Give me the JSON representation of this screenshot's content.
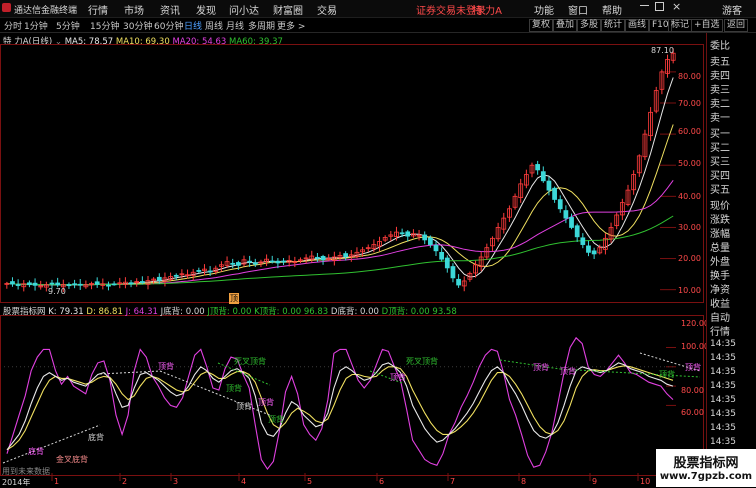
{
  "menu": {
    "app_title": "通达信金融终端",
    "items": [
      "行情",
      "市场",
      "资讯",
      "发现",
      "问小达",
      "财富圈",
      "交易"
    ],
    "right_items": [
      "功能",
      "窗口",
      "帮助",
      "游客"
    ],
    "login_warning": "证券交易未登录",
    "stock_tag": "特 力A"
  },
  "periods": {
    "items": [
      "分时",
      "1分钟",
      "5分钟",
      "15分钟",
      "30分钟",
      "60分钟",
      "日线",
      "周线",
      "月线",
      "多周期",
      "更多 >"
    ],
    "selected": "日线"
  },
  "tools": [
    "复权",
    "叠加",
    "多股",
    "统计",
    "画线",
    "F10",
    "标记",
    "+自选",
    "返回"
  ],
  "price_info": {
    "name": "特 力A(日线)",
    "ma5": "MA5: 78.57",
    "ma10": "MA10: 69.30",
    "ma20": "MA20: 54.63",
    "ma60": "MA60: 39.37"
  },
  "price_axis": [
    "80.00",
    "70.00",
    "60.00",
    "50.00",
    "40.00",
    "30.00",
    "20.00",
    "10.00"
  ],
  "price_marks": {
    "high": "87.10",
    "low": "9.70",
    "ding": "顶"
  },
  "indicator_info": {
    "name": "股票指标网",
    "k": "K: 79.31",
    "d": "D: 86.81",
    "j": "J: 64.31",
    "j_di": "J底背: 0.00",
    "j_ding": "J顶背: 0.00",
    "k_ding": "K顶背: 0.00",
    "v1": "96.83",
    "d_di": "D底背: 0.00",
    "d_ding": "D顶背: 0.00",
    "v2": "93.58"
  },
  "indicator_axis": [
    "120.00",
    "100.00",
    "80.00",
    "60.00"
  ],
  "indicator_labels": {
    "ding_bei": "顶背",
    "di_bei": "底背",
    "si_cha": "死叉顶背",
    "jin_cha": "金叉底背"
  },
  "date_axis": [
    "2014年",
    "1",
    "2",
    "3",
    "4",
    "5",
    "6",
    "7",
    "8",
    "9",
    "10"
  ],
  "footer_note": "用到未来数据",
  "side_panel": {
    "top": "委比",
    "rows": [
      "卖五",
      "卖四",
      "卖三",
      "卖二",
      "卖一",
      "买一",
      "买二",
      "买三",
      "买四",
      "买五",
      "现价",
      "涨跌",
      "涨幅",
      "总量",
      "外盘",
      "换手",
      "净资",
      "收益"
    ],
    "bottom": [
      "自动",
      "行情",
      "14:35",
      "14:35",
      "14:35",
      "14:35",
      "14:35",
      "14:35",
      "14:35",
      "14:35"
    ]
  },
  "watermark": {
    "line1": "股票指标网",
    "line2": "www.7gpzb.com"
  },
  "colors": {
    "up": "#ff3c3c",
    "down": "#3cd8d8",
    "ma5": "#e8e8e8",
    "ma10": "#f0e060",
    "ma20": "#e040e0",
    "ma60": "#30c030",
    "k": "#e8e8e8",
    "d": "#f0e060",
    "j": "#e040e0"
  },
  "chart_data": {
    "type": "candlestick",
    "ylim": [
      7,
      88
    ],
    "closes": [
      12,
      11.8,
      11.5,
      11.9,
      11.6,
      11.4,
      11.2,
      11.6,
      11.9,
      11.5,
      11.7,
      11.3,
      11.8,
      11.5,
      11.6,
      12.0,
      11.7,
      11.9,
      11.4,
      11.8,
      12.2,
      12.4,
      12.0,
      12.6,
      12.3,
      12.9,
      13.4,
      13.0,
      13.8,
      14.2,
      14.6,
      15.1,
      14.8,
      15.6,
      16.0,
      16.6,
      15.8,
      16.9,
      18.0,
      19.0,
      18.4,
      17.8,
      19.6,
      19.0,
      18.2,
      18.9,
      19.8,
      19.2,
      18.6,
      18.9,
      19.4,
      19.0,
      19.6,
      20.2,
      20.8,
      20.2,
      19.6,
      20.0,
      20.5,
      21.0,
      20.6,
      21.2,
      22.0,
      22.8,
      23.5,
      24.5,
      25.5,
      26.8,
      27.6,
      28.5,
      28.0,
      27.2,
      28.0,
      27.5,
      26.0,
      24.5,
      22.5,
      19.8,
      17.0,
      13.8,
      11.5,
      12.8,
      15.2,
      18.0,
      20.5,
      23.5,
      26.5,
      30.0,
      33.0,
      36.0,
      40.0,
      44.0,
      47.0,
      50.0,
      48.5,
      45.0,
      42.0,
      39.0,
      36.0,
      33.0,
      30.0,
      27.0,
      24.5,
      22.0,
      21.5,
      23.5,
      26.5,
      30.0,
      34.0,
      38.0,
      42.0,
      47.0,
      53.0,
      60.0,
      67.0,
      74.0,
      80.0,
      84.0,
      86.0
    ],
    "ma_series": [
      "MA5",
      "MA10",
      "MA20",
      "MA60"
    ],
    "kdj_k": [
      14,
      22,
      30,
      44,
      62,
      78,
      90,
      94,
      90,
      86,
      88,
      84,
      82,
      80,
      86,
      92,
      94,
      88,
      72,
      58,
      60,
      78,
      92,
      94,
      90,
      86,
      80,
      74,
      70,
      72,
      80,
      92,
      100,
      96,
      88,
      84,
      90,
      96,
      98,
      94,
      88,
      70,
      42,
      30,
      28,
      36,
      52,
      64,
      60,
      50,
      44,
      38,
      40,
      52,
      78,
      96,
      100,
      96,
      90,
      86,
      88,
      94,
      102,
      104,
      100,
      94,
      80,
      60,
      48,
      36,
      28,
      22,
      24,
      30,
      36,
      44,
      52,
      62,
      74,
      86,
      96,
      100,
      94,
      82,
      72,
      60,
      46,
      34,
      28,
      26,
      30,
      42,
      60,
      80,
      96,
      100,
      98,
      96,
      94,
      96,
      100,
      104,
      102,
      98,
      96,
      94,
      90,
      88,
      86,
      82,
      80
    ],
    "kdj_d": [
      14,
      18,
      24,
      34,
      48,
      62,
      76,
      86,
      90,
      88,
      88,
      86,
      84,
      82,
      84,
      88,
      90,
      89,
      82,
      72,
      66,
      70,
      80,
      88,
      90,
      88,
      84,
      80,
      76,
      74,
      76,
      84,
      92,
      95,
      92,
      88,
      88,
      92,
      95,
      95,
      92,
      84,
      68,
      52,
      40,
      36,
      42,
      52,
      57,
      54,
      50,
      44,
      42,
      46,
      60,
      76,
      88,
      92,
      92,
      90,
      89,
      90,
      96,
      100,
      100,
      98,
      90,
      76,
      64,
      52,
      42,
      34,
      30,
      30,
      33,
      38,
      44,
      52,
      62,
      74,
      86,
      94,
      94,
      90,
      82,
      72,
      60,
      48,
      38,
      32,
      30,
      34,
      44,
      60,
      78,
      90,
      96,
      97,
      96,
      96,
      98,
      100,
      101,
      100,
      98,
      96,
      94,
      92,
      90,
      88,
      86
    ],
    "kdj_j": [
      10,
      30,
      50,
      70,
      96,
      110,
      118,
      118,
      96,
      82,
      90,
      80,
      76,
      72,
      92,
      104,
      106,
      86,
      50,
      30,
      50,
      96,
      118,
      110,
      90,
      80,
      68,
      60,
      58,
      68,
      90,
      112,
      118,
      100,
      78,
      76,
      98,
      110,
      108,
      92,
      78,
      40,
      4,
      -6,
      2,
      34,
      74,
      90,
      72,
      40,
      30,
      24,
      36,
      66,
      114,
      118,
      118,
      102,
      86,
      78,
      86,
      102,
      118,
      116,
      100,
      86,
      56,
      24,
      14,
      4,
      0,
      -2,
      10,
      30,
      42,
      58,
      70,
      84,
      100,
      112,
      118,
      116,
      94,
      66,
      50,
      30,
      8,
      -4,
      -2,
      12,
      32,
      62,
      94,
      120,
      130,
      124,
      100,
      92,
      90,
      96,
      104,
      112,
      104,
      94,
      92,
      88,
      84,
      82,
      80,
      72,
      66
    ]
  }
}
